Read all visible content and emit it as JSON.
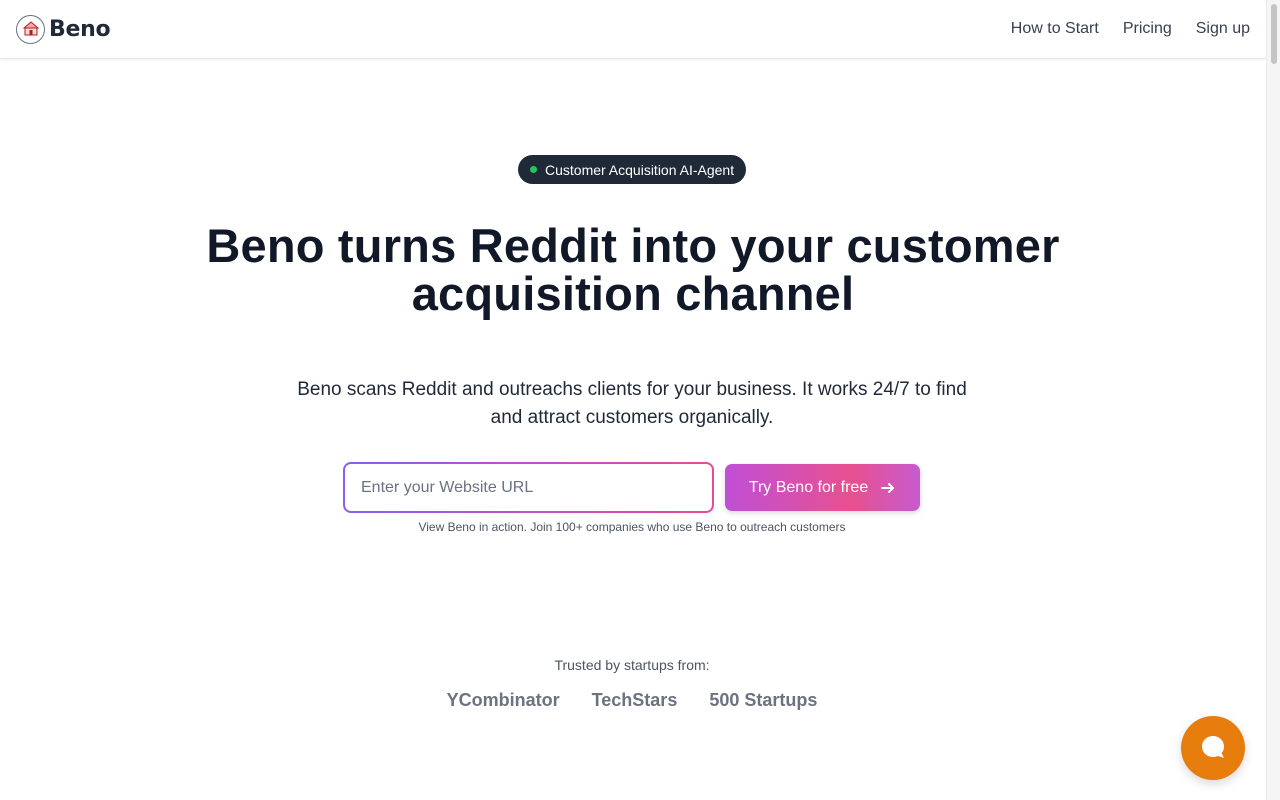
{
  "header": {
    "brand_name": "Beno",
    "nav": [
      {
        "label": "How to Start"
      },
      {
        "label": "Pricing"
      },
      {
        "label": "Sign up"
      }
    ]
  },
  "hero": {
    "badge_label": "Customer Acquisition AI-Agent",
    "headline": "Beno turns Reddit into your customer acquisition channel",
    "subheadline": "Beno scans Reddit and outreachs clients for your business. It works 24/7 to find and attract customers organically.",
    "url_input": {
      "value": "",
      "placeholder": "Enter your Website URL"
    },
    "cta_label": "Try Beno for free",
    "cta_note": "View Beno in action. Join 100+ companies who use Beno to outreach customers"
  },
  "trusted": {
    "label": "Trusted by startups from:",
    "logos": [
      "YCombinator",
      "TechStars",
      "500 Startups"
    ]
  },
  "icons": {
    "brand": "beno-logo-icon",
    "badge": "status-dot-icon",
    "cta": "arrow-right-icon",
    "chat": "chat-bubble-icon"
  },
  "colors": {
    "accent_start": "#8b5cf6",
    "accent_end": "#ec4899",
    "badge_bg": "#1f2937",
    "badge_dot": "#22c55e",
    "chat_button": "#e77d0c",
    "headline": "#111827"
  }
}
